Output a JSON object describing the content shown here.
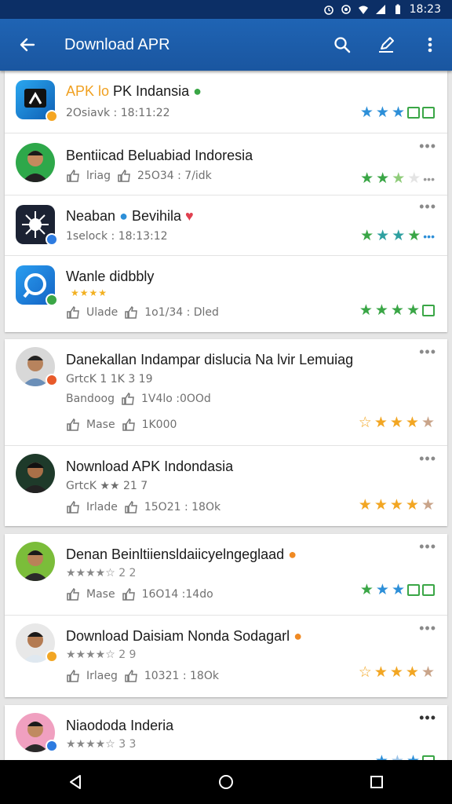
{
  "status_bar": {
    "time": "18:23"
  },
  "app_bar": {
    "title": "Download APR"
  },
  "items": [
    {
      "title_part1": "APK lo",
      "title_part2": " PK Indansia",
      "subtitle": "2Osiavk : 18:11:22"
    },
    {
      "title": "Bentiicad Beluabiad Indoresia",
      "likes_label": "lriag",
      "count": "25O34 : 7/idk"
    },
    {
      "title": "Neaban",
      "title_part2": " Bevihila",
      "subtitle": "1selock : 18:13:12"
    },
    {
      "title": "Wanle didbbly",
      "likes_label": "Ulade",
      "count": "1o1/34 : Dled"
    },
    {
      "title": "Danekallan Indampar dislucia Na lvir Lemuiag",
      "subtitle": "GrtcK 1 1K 3 19",
      "line2_label": "Bandoog",
      "line2_count": "1V4lo :0OOd",
      "likes_label": "Mase",
      "count": "1K000"
    },
    {
      "title": "Nownload APK Indondasia",
      "subtitle": "GrtcK ★★ 21 7",
      "likes_label": "Irlade",
      "count": "15O21 : 18Ok"
    },
    {
      "title": "Denan Beinltiiensldaiicyelngeglaad",
      "subtitle": "★★★★☆ 2 2",
      "likes_label": "Mase",
      "count": "16O14 :14do"
    },
    {
      "title": "Download Daisiam Nonda Sodagarl",
      "subtitle": "★★★★☆ 2 9",
      "likes_label": "Irlaeg",
      "count": "10321 : 18Ok"
    },
    {
      "title": "Niaododa Inderia",
      "subtitle": "★★★★☆ 3 3"
    }
  ],
  "colors": {
    "app_bar": "#1a56a0",
    "status_bar": "#0c2f66",
    "star_blue": "#2d8fd8",
    "star_green": "#3aa646",
    "star_orange": "#f2a623"
  },
  "icons": [
    "back-arrow-icon",
    "search-icon",
    "edit-icon",
    "more-vert-icon",
    "thumb-up-icon",
    "star-icon",
    "back-nav-icon",
    "home-nav-icon",
    "recents-nav-icon"
  ]
}
